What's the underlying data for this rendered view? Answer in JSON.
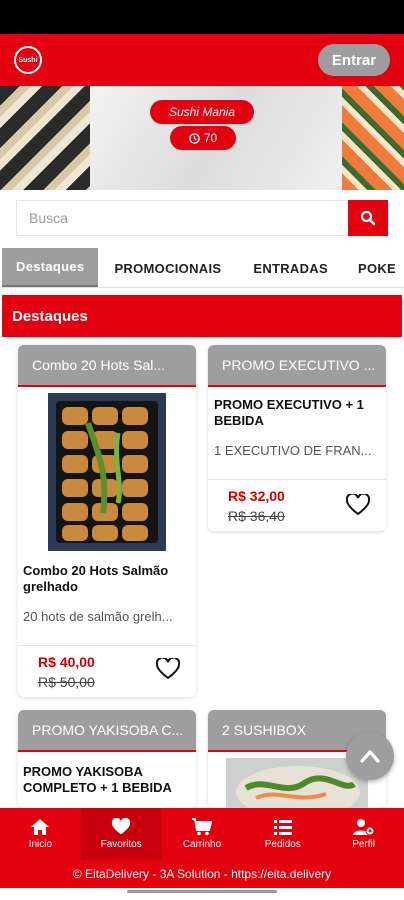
{
  "header": {
    "logo_text": "Sushi",
    "login_label": "Entrar"
  },
  "banner": {
    "store_name": "Sushi Mania",
    "delivery_time": "70"
  },
  "search": {
    "placeholder": "Busca"
  },
  "tabs": [
    {
      "label": "Destaques",
      "active": true
    },
    {
      "label": "PROMOCIONAIS"
    },
    {
      "label": "ENTRADAS"
    },
    {
      "label": "POKE"
    }
  ],
  "section": {
    "title": "Destaques"
  },
  "products": [
    {
      "head": "Combo 20 Hots Sal...",
      "title": "Combo 20 Hots Salmão grelhado",
      "desc": "20 hots de salmão grelh...",
      "price": "R$ 40,00",
      "old_price": "R$ 50,00"
    },
    {
      "head": "PROMO EXECUTIVO ...",
      "title": "PROMO EXECUTIVO + 1 BEBIDA",
      "desc": "1 EXECUTIVO DE FRAN...",
      "price": "R$ 32,00",
      "old_price": "R$ 36,40"
    },
    {
      "head": "PROMO YAKISOBA C...",
      "title": "PROMO YAKISOBA COMPLETO + 1 BEBIDA"
    },
    {
      "head": "2 SUSHIBOX"
    }
  ],
  "bottom_nav": [
    {
      "label": "Inicio",
      "icon": "home-icon"
    },
    {
      "label": "Favoritos",
      "icon": "heart-icon",
      "active": true
    },
    {
      "label": "Carrinho",
      "icon": "cart-icon"
    },
    {
      "label": "Pedidos",
      "icon": "list-icon"
    },
    {
      "label": "Perfil",
      "icon": "user-gear-icon"
    }
  ],
  "footer": {
    "text": "© EitaDelivery - 3A Solution - https://eita.delivery"
  },
  "colors": {
    "brand_red": "#e3000f",
    "gray": "#9e9e9e",
    "price_red": "#c00000"
  }
}
